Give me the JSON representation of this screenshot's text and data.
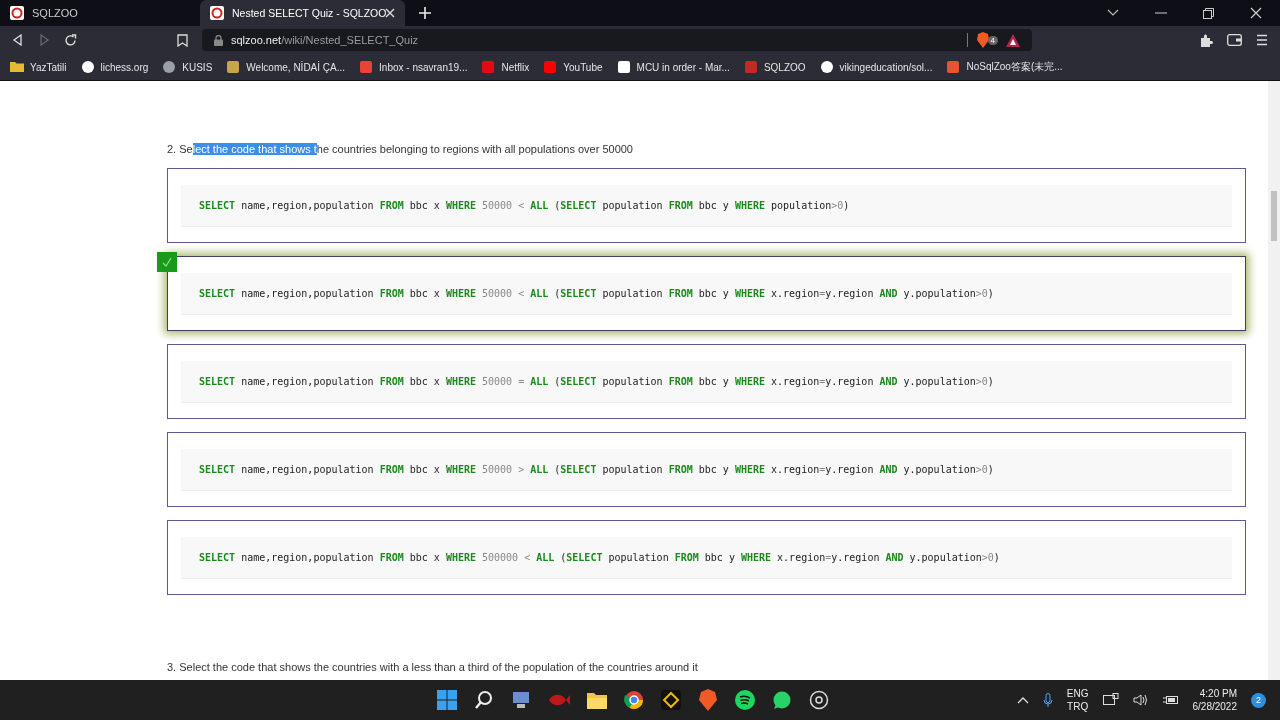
{
  "browser": {
    "tabs": [
      {
        "title": "SQLZOO",
        "selected": false
      },
      {
        "title": "Nested SELECT Quiz - SQLZOO",
        "selected": true
      }
    ],
    "url": {
      "host": "sqlzoo.net",
      "path": "/wiki/Nested_SELECT_Quiz"
    },
    "shield_badge": "4",
    "bookmarks": [
      {
        "label": "YazTatili"
      },
      {
        "label": "lichess.org"
      },
      {
        "label": "KUSIS"
      },
      {
        "label": "Welcome, NİDAİ ÇA..."
      },
      {
        "label": "Inbox - nsavran19..."
      },
      {
        "label": "Netflix"
      },
      {
        "label": "YouTube"
      },
      {
        "label": "MCU in order - Mar..."
      },
      {
        "label": "SQLZOO"
      },
      {
        "label": "vikingeducation/sol..."
      },
      {
        "label": "NoSqlZoo答案(未完..."
      }
    ]
  },
  "question": {
    "parts": [
      {
        "text": "2. Se",
        "highlighted": false
      },
      {
        "text": "lect the code that shows t",
        "highlighted": true
      },
      {
        "text": "he countries belonging to regions with all populations over 50000",
        "highlighted": false
      }
    ]
  },
  "options": [
    {
      "selected": false,
      "code": [
        {
          "kind": "keyword",
          "t": "SELECT"
        },
        {
          "kind": "plain",
          "t": " name,region,population "
        },
        {
          "kind": "keyword",
          "t": "FROM"
        },
        {
          "kind": "plain",
          "t": " bbc x "
        },
        {
          "kind": "keyword",
          "t": "WHERE"
        },
        {
          "kind": "literal",
          "t": " 50000 < "
        },
        {
          "kind": "keyword",
          "t": "ALL"
        },
        {
          "kind": "plain",
          "t": " ("
        },
        {
          "kind": "keyword",
          "t": "SELECT"
        },
        {
          "kind": "plain",
          "t": " population "
        },
        {
          "kind": "keyword",
          "t": "FROM"
        },
        {
          "kind": "plain",
          "t": " bbc y "
        },
        {
          "kind": "keyword",
          "t": "WHERE"
        },
        {
          "kind": "plain",
          "t": " population"
        },
        {
          "kind": "literal",
          "t": ">0"
        },
        {
          "kind": "plain",
          "t": ")"
        }
      ]
    },
    {
      "selected": true,
      "code": [
        {
          "kind": "keyword",
          "t": "SELECT"
        },
        {
          "kind": "plain",
          "t": " name,region,population "
        },
        {
          "kind": "keyword",
          "t": "FROM"
        },
        {
          "kind": "plain",
          "t": " bbc x "
        },
        {
          "kind": "keyword",
          "t": "WHERE"
        },
        {
          "kind": "literal",
          "t": " 50000 < "
        },
        {
          "kind": "keyword",
          "t": "ALL"
        },
        {
          "kind": "plain",
          "t": " ("
        },
        {
          "kind": "keyword",
          "t": "SELECT"
        },
        {
          "kind": "plain",
          "t": " population "
        },
        {
          "kind": "keyword",
          "t": "FROM"
        },
        {
          "kind": "plain",
          "t": " bbc y "
        },
        {
          "kind": "keyword",
          "t": "WHERE"
        },
        {
          "kind": "plain",
          "t": " x.region"
        },
        {
          "kind": "literal",
          "t": "="
        },
        {
          "kind": "plain",
          "t": "y.region "
        },
        {
          "kind": "keyword",
          "t": "AND"
        },
        {
          "kind": "plain",
          "t": " y.population"
        },
        {
          "kind": "literal",
          "t": ">0"
        },
        {
          "kind": "plain",
          "t": ")"
        }
      ]
    },
    {
      "selected": false,
      "code": [
        {
          "kind": "keyword",
          "t": "SELECT"
        },
        {
          "kind": "plain",
          "t": " name,region,population "
        },
        {
          "kind": "keyword",
          "t": "FROM"
        },
        {
          "kind": "plain",
          "t": " bbc x "
        },
        {
          "kind": "keyword",
          "t": "WHERE"
        },
        {
          "kind": "literal",
          "t": " 50000 = "
        },
        {
          "kind": "keyword",
          "t": "ALL"
        },
        {
          "kind": "plain",
          "t": " ("
        },
        {
          "kind": "keyword",
          "t": "SELECT"
        },
        {
          "kind": "plain",
          "t": " population "
        },
        {
          "kind": "keyword",
          "t": "FROM"
        },
        {
          "kind": "plain",
          "t": " bbc y "
        },
        {
          "kind": "keyword",
          "t": "WHERE"
        },
        {
          "kind": "plain",
          "t": " x.region"
        },
        {
          "kind": "literal",
          "t": "="
        },
        {
          "kind": "plain",
          "t": "y.region "
        },
        {
          "kind": "keyword",
          "t": "AND"
        },
        {
          "kind": "plain",
          "t": " y.population"
        },
        {
          "kind": "literal",
          "t": ">0"
        },
        {
          "kind": "plain",
          "t": ")"
        }
      ]
    },
    {
      "selected": false,
      "code": [
        {
          "kind": "keyword",
          "t": "SELECT"
        },
        {
          "kind": "plain",
          "t": " name,region,population "
        },
        {
          "kind": "keyword",
          "t": "FROM"
        },
        {
          "kind": "plain",
          "t": " bbc x "
        },
        {
          "kind": "keyword",
          "t": "WHERE"
        },
        {
          "kind": "literal",
          "t": " 50000 > "
        },
        {
          "kind": "keyword",
          "t": "ALL"
        },
        {
          "kind": "plain",
          "t": " ("
        },
        {
          "kind": "keyword",
          "t": "SELECT"
        },
        {
          "kind": "plain",
          "t": " population "
        },
        {
          "kind": "keyword",
          "t": "FROM"
        },
        {
          "kind": "plain",
          "t": " bbc y "
        },
        {
          "kind": "keyword",
          "t": "WHERE"
        },
        {
          "kind": "plain",
          "t": " x.region"
        },
        {
          "kind": "literal",
          "t": "="
        },
        {
          "kind": "plain",
          "t": "y.region "
        },
        {
          "kind": "keyword",
          "t": "AND"
        },
        {
          "kind": "plain",
          "t": " y.population"
        },
        {
          "kind": "literal",
          "t": ">0"
        },
        {
          "kind": "plain",
          "t": ")"
        }
      ]
    },
    {
      "selected": false,
      "code": [
        {
          "kind": "keyword",
          "t": "SELECT"
        },
        {
          "kind": "plain",
          "t": " name,region,population "
        },
        {
          "kind": "keyword",
          "t": "FROM"
        },
        {
          "kind": "plain",
          "t": " bbc x "
        },
        {
          "kind": "keyword",
          "t": "WHERE"
        },
        {
          "kind": "literal",
          "t": " 500000 < "
        },
        {
          "kind": "keyword",
          "t": "ALL"
        },
        {
          "kind": "plain",
          "t": " ("
        },
        {
          "kind": "keyword",
          "t": "SELECT"
        },
        {
          "kind": "plain",
          "t": " population "
        },
        {
          "kind": "keyword",
          "t": "FROM"
        },
        {
          "kind": "plain",
          "t": " bbc y "
        },
        {
          "kind": "keyword",
          "t": "WHERE"
        },
        {
          "kind": "plain",
          "t": " x.region"
        },
        {
          "kind": "literal",
          "t": "="
        },
        {
          "kind": "plain",
          "t": "y.region "
        },
        {
          "kind": "keyword",
          "t": "AND"
        },
        {
          "kind": "plain",
          "t": " y.population"
        },
        {
          "kind": "literal",
          "t": ">0"
        },
        {
          "kind": "plain",
          "t": ")"
        }
      ]
    }
  ],
  "next_question": "3. Select the code that shows the countries with a less than a third of the population of the countries around it",
  "taskbar": {
    "language": "ENG",
    "layout": "TRQ",
    "time": "4:20 PM",
    "date": "6/28/2022",
    "notifications": "2"
  }
}
